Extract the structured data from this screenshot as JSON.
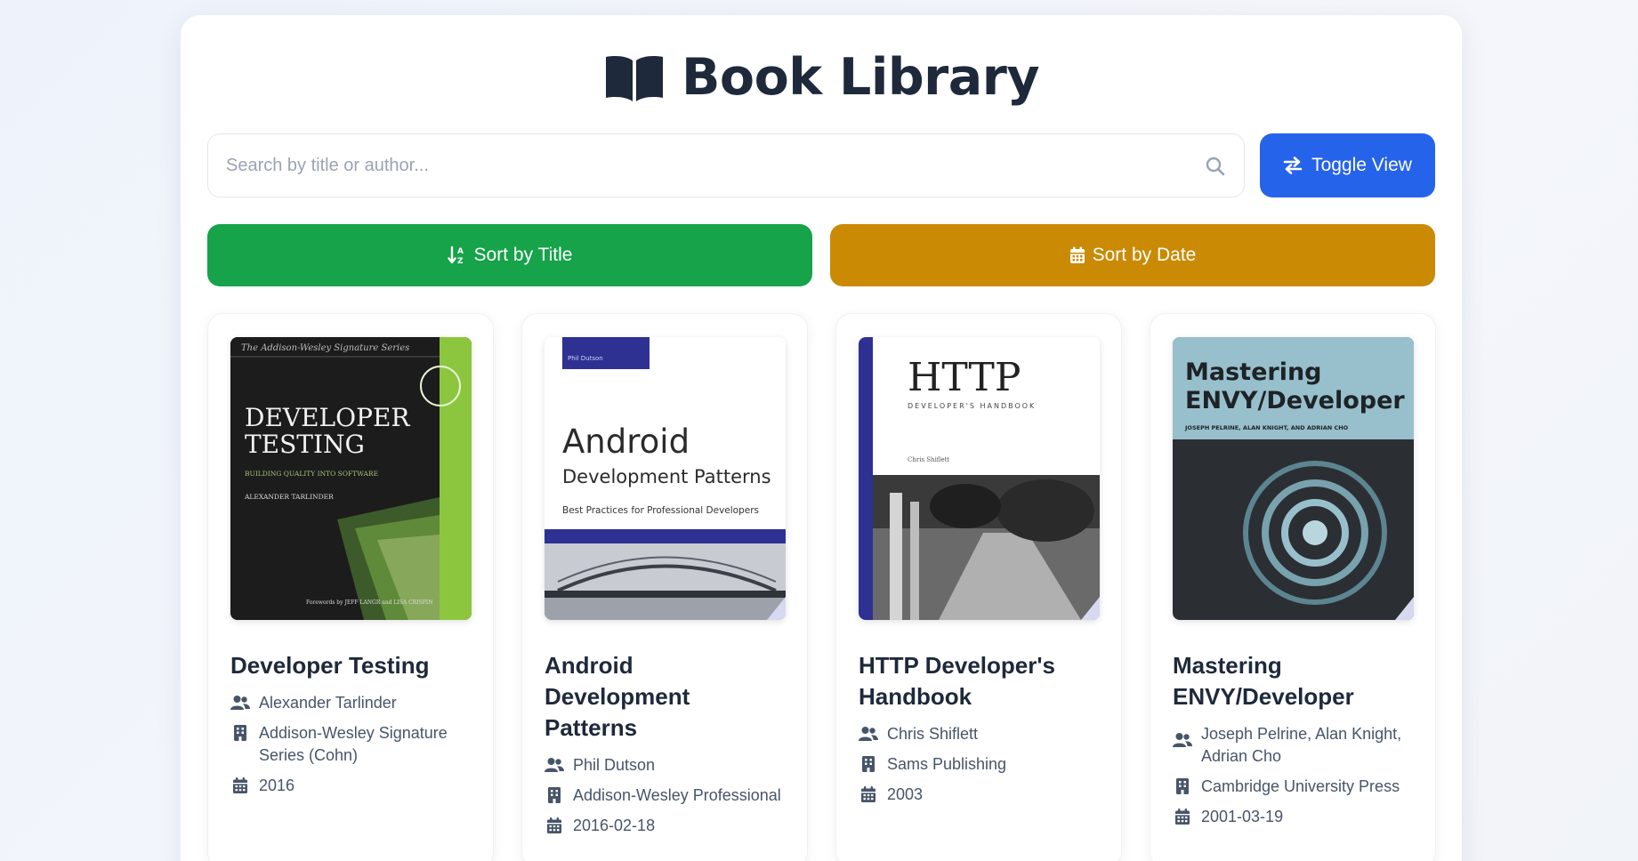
{
  "header": {
    "title": "Book Library",
    "icon": "book-open-icon"
  },
  "search": {
    "placeholder": "Search by title or author...",
    "value": "",
    "icon": "search-icon"
  },
  "toolbar": {
    "toggle_label": "Toggle View",
    "sort_title_label": "Sort by Title",
    "sort_date_label": "Sort by Date"
  },
  "colors": {
    "accent_blue": "#2563eb",
    "sort_title_green": "#16a34a",
    "sort_date_amber": "#ca8a04",
    "text_dark": "#1e293b",
    "text_muted": "#475569"
  },
  "books": [
    {
      "title": "Developer Testing",
      "authors": "Alexander Tarlinder",
      "publisher": "Addison-Wesley Signature Series (Cohn)",
      "date": "2016",
      "cover": {
        "series": "The Addison-Wesley Signature Series",
        "line1": "DEVELOPER",
        "line2": "TESTING",
        "subtitle": "BUILDING QUALITY INTO SOFTWARE",
        "author": "ALEXANDER TARLINDER",
        "foreword": "Forewords by JEFF LANGR and LISA CRISPIN"
      }
    },
    {
      "title": "Android Development Patterns",
      "authors": "Phil Dutson",
      "publisher": "Addison-Wesley Professional",
      "date": "2016-02-18",
      "cover": {
        "tag": "Phil Dutson",
        "line1": "Android",
        "line2": "Development Patterns",
        "subtitle": "Best Practices for Professional Developers"
      }
    },
    {
      "title": "HTTP Developer's Handbook",
      "authors": "Chris Shiflett",
      "publisher": "Sams Publishing",
      "date": "2003",
      "cover": {
        "line1": "HTTP",
        "line2": "DEVELOPER'S HANDBOOK",
        "author": "Chris Shiflett"
      }
    },
    {
      "title": "Mastering ENVY/Developer",
      "authors": "Joseph Pelrine, Alan Knight, Adrian Cho",
      "publisher": "Cambridge University Press",
      "date": "2001-03-19",
      "cover": {
        "line1": "Mastering",
        "line2": "ENVY/Developer",
        "author": "JOSEPH PELRINE, ALAN KNIGHT, AND ADRIAN CHO"
      }
    }
  ]
}
